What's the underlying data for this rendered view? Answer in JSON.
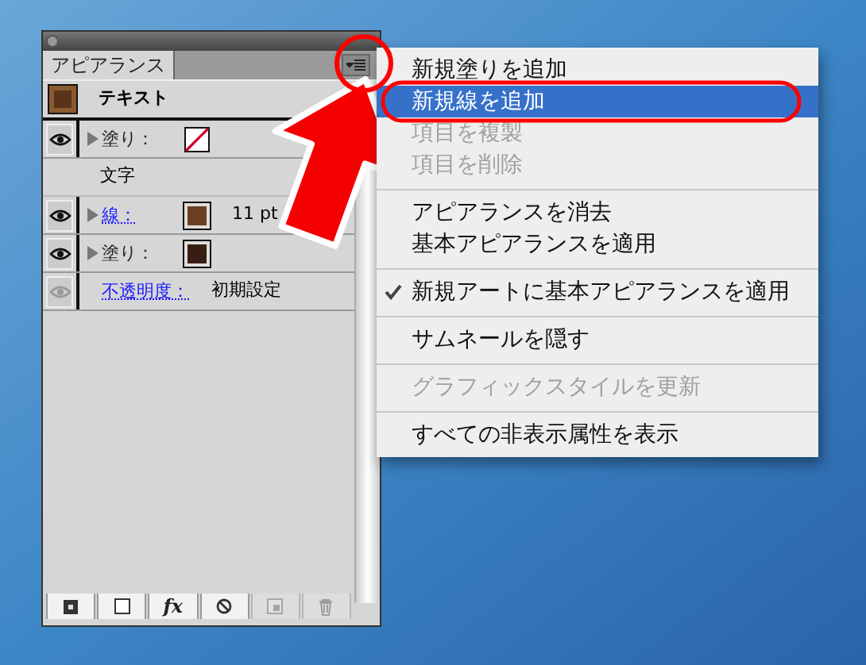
{
  "panel": {
    "tab": {
      "label": "アピアランス",
      "selected": true
    },
    "rows": [
      {
        "kind": "thumbnail",
        "label": "テキスト",
        "color": "#5a3418"
      },
      {
        "kind": "attribute",
        "eye": true,
        "eye_dimmed": false,
        "expandable": true,
        "label": "塗り：",
        "link": false,
        "swatch": {
          "kind": "none"
        }
      },
      {
        "kind": "text",
        "label": "文字"
      },
      {
        "kind": "attribute",
        "eye": true,
        "eye_dimmed": false,
        "expandable": true,
        "label": "線：",
        "link": true,
        "swatch": {
          "kind": "color",
          "color": "#6b3f1f"
        },
        "value": "11 pt"
      },
      {
        "kind": "attribute",
        "eye": true,
        "eye_dimmed": false,
        "expandable": true,
        "label": "塗り：",
        "link": false,
        "swatch": {
          "kind": "color",
          "color": "#3a1d12"
        }
      },
      {
        "kind": "attribute",
        "eye": true,
        "eye_dimmed": true,
        "expandable": false,
        "label": "不透明度：",
        "link": true,
        "value": "初期設定"
      }
    ],
    "toolbar": [
      {
        "kind": "filled-square",
        "disabled": false
      },
      {
        "kind": "empty-square",
        "disabled": false
      },
      {
        "kind": "fx",
        "label": "fx",
        "disabled": false
      },
      {
        "kind": "no-sign",
        "disabled": false
      },
      {
        "kind": "new-item",
        "disabled": true
      },
      {
        "kind": "trash",
        "disabled": true
      }
    ]
  },
  "menu": {
    "items": [
      {
        "kind": "item",
        "label": "新規塗りを追加",
        "disabled": false,
        "selected": false,
        "checked": false
      },
      {
        "kind": "item",
        "label": "新規線を追加",
        "disabled": false,
        "selected": true,
        "checked": false
      },
      {
        "kind": "item",
        "label": "項目を複製",
        "disabled": true,
        "selected": false,
        "checked": false
      },
      {
        "kind": "item",
        "label": "項目を削除",
        "disabled": true,
        "selected": false,
        "checked": false
      },
      {
        "kind": "separator"
      },
      {
        "kind": "item",
        "label": "アピアランスを消去",
        "disabled": false,
        "selected": false,
        "checked": false
      },
      {
        "kind": "item",
        "label": "基本アピアランスを適用",
        "disabled": false,
        "selected": false,
        "checked": false
      },
      {
        "kind": "separator"
      },
      {
        "kind": "item",
        "label": "新規アートに基本アピアランスを適用",
        "disabled": false,
        "selected": false,
        "checked": true
      },
      {
        "kind": "separator"
      },
      {
        "kind": "item",
        "label": "サムネールを隠す",
        "disabled": false,
        "selected": false,
        "checked": false
      },
      {
        "kind": "separator"
      },
      {
        "kind": "item",
        "label": "グラフィックスタイルを更新",
        "disabled": true,
        "selected": false,
        "checked": false
      },
      {
        "kind": "separator"
      },
      {
        "kind": "item",
        "label": "すべての非表示属性を表示",
        "disabled": false,
        "selected": false,
        "checked": false
      }
    ]
  }
}
